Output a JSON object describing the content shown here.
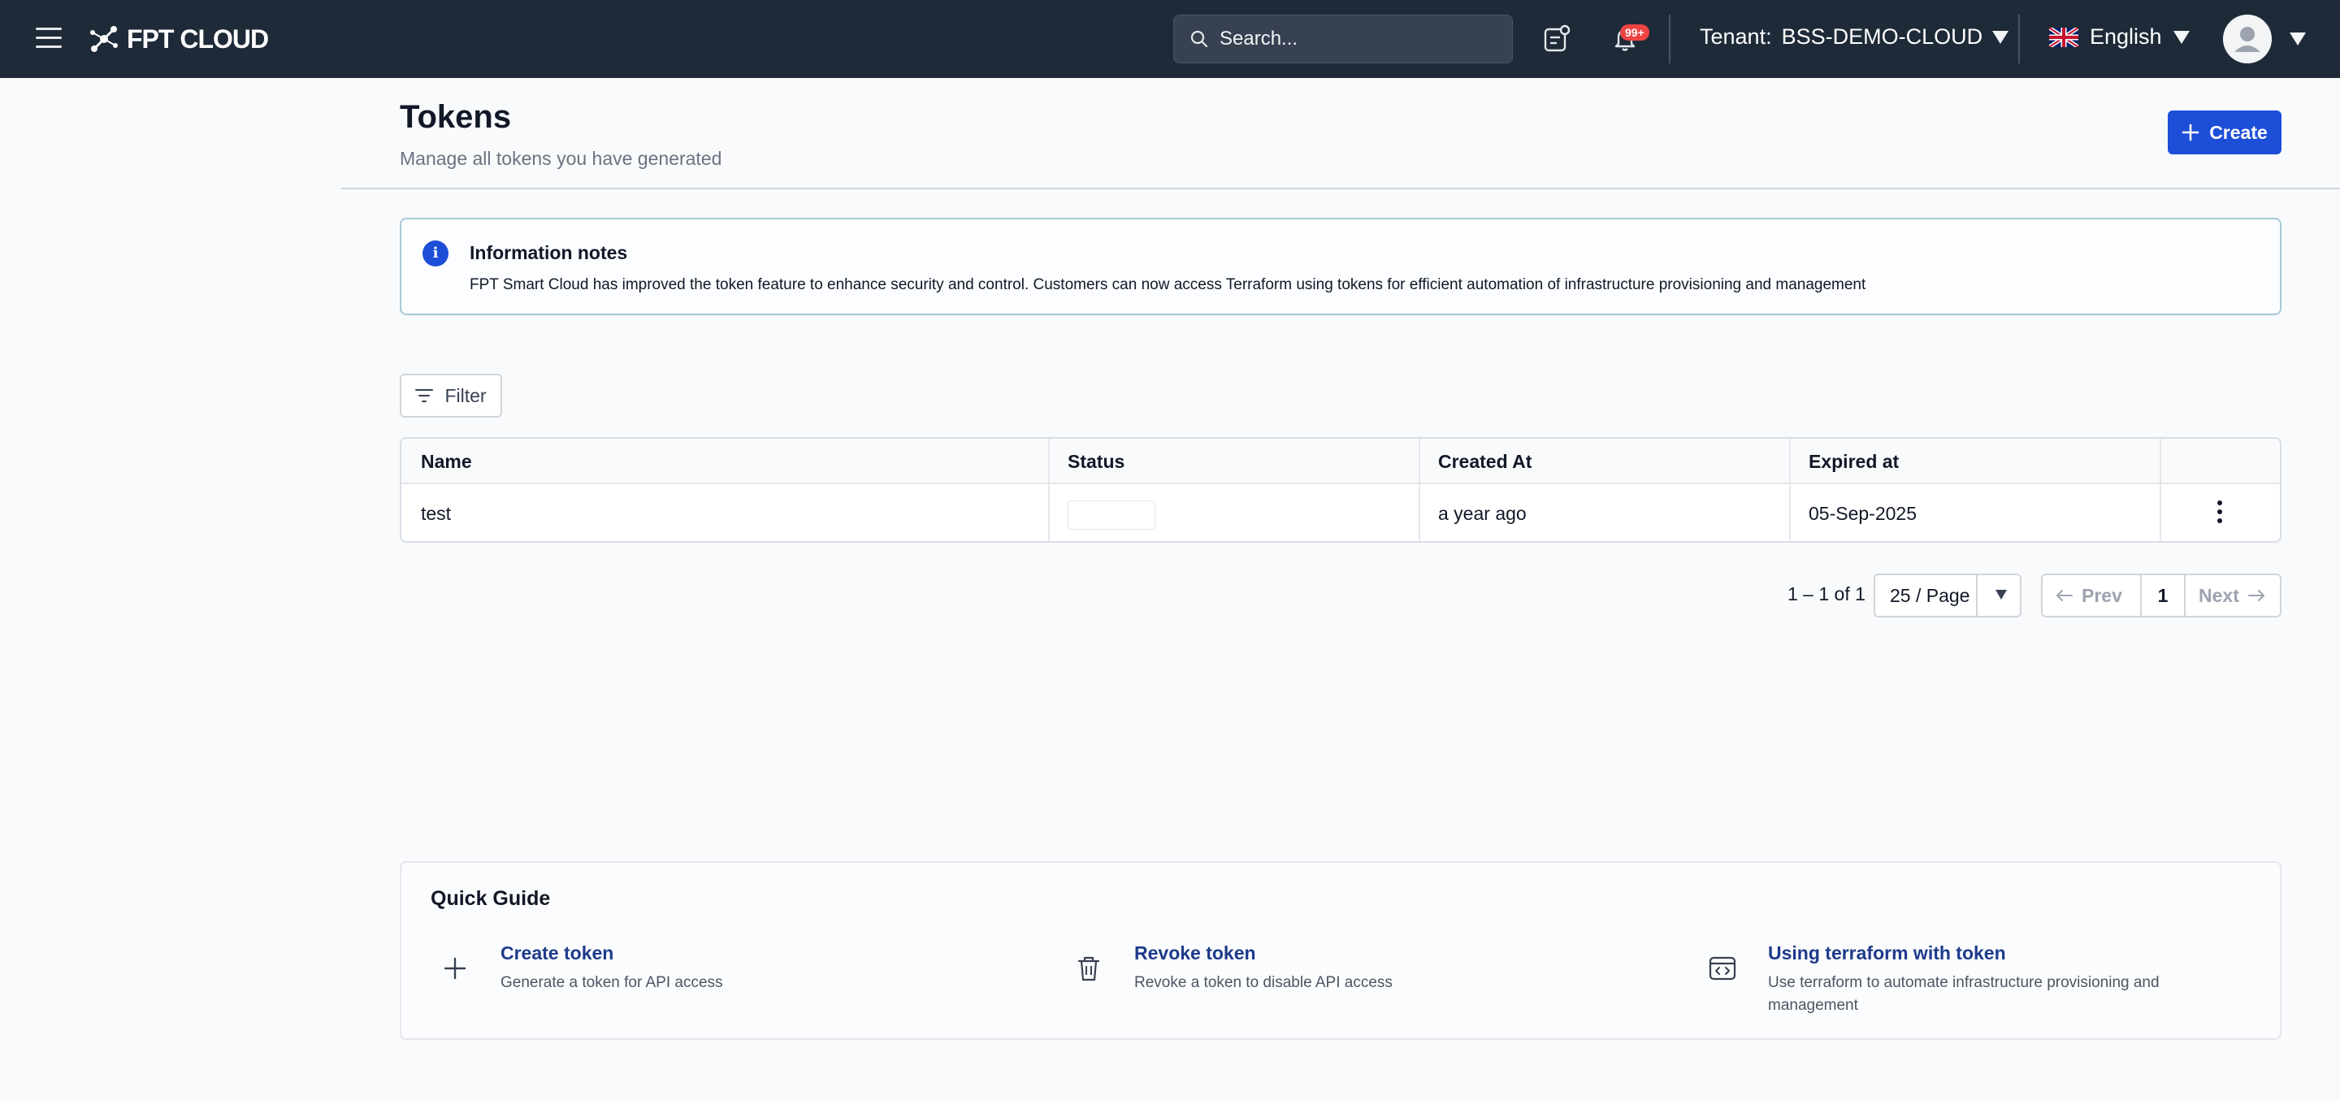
{
  "navbar": {
    "logo_text": "FPT CLOUD",
    "search_placeholder": "Search...",
    "notification_badge": "99+",
    "tenant_label": "Tenant:",
    "tenant_value": "BSS-DEMO-CLOUD",
    "language": "English"
  },
  "header": {
    "title": "Tokens",
    "subtitle": "Manage all tokens you have generated",
    "create_label": "Create"
  },
  "info": {
    "title": "Information notes",
    "text": "FPT Smart Cloud has improved the token feature to enhance security and control. Customers can now access Terraform using tokens for efficient automation of infrastructure provisioning and management"
  },
  "filter": {
    "label": "Filter"
  },
  "table": {
    "columns": [
      "Name",
      "Status",
      "Created At",
      "Expired at"
    ],
    "rows": [
      {
        "name": "test",
        "status": "",
        "created_at": "a year ago",
        "expired_at": "05-Sep-2025"
      }
    ]
  },
  "pagination": {
    "range": "1 – 1 of 1",
    "page_size": "25 / Page",
    "prev": "Prev",
    "current": "1",
    "next": "Next"
  },
  "guide": {
    "title": "Quick Guide",
    "items": [
      {
        "title": "Create token",
        "desc": "Generate a token for API access",
        "icon": "plus-icon"
      },
      {
        "title": "Revoke token",
        "desc": "Revoke a token to disable API access",
        "icon": "trash-icon"
      },
      {
        "title": "Using terraform with token",
        "desc": "Use terraform to automate infrastructure provisioning and management",
        "icon": "code-window-icon"
      }
    ]
  },
  "colors": {
    "navbar_bg": "#1e2a38",
    "primary": "#1d4ed8",
    "link": "#1e3a8a",
    "badge": "#ef4444"
  }
}
